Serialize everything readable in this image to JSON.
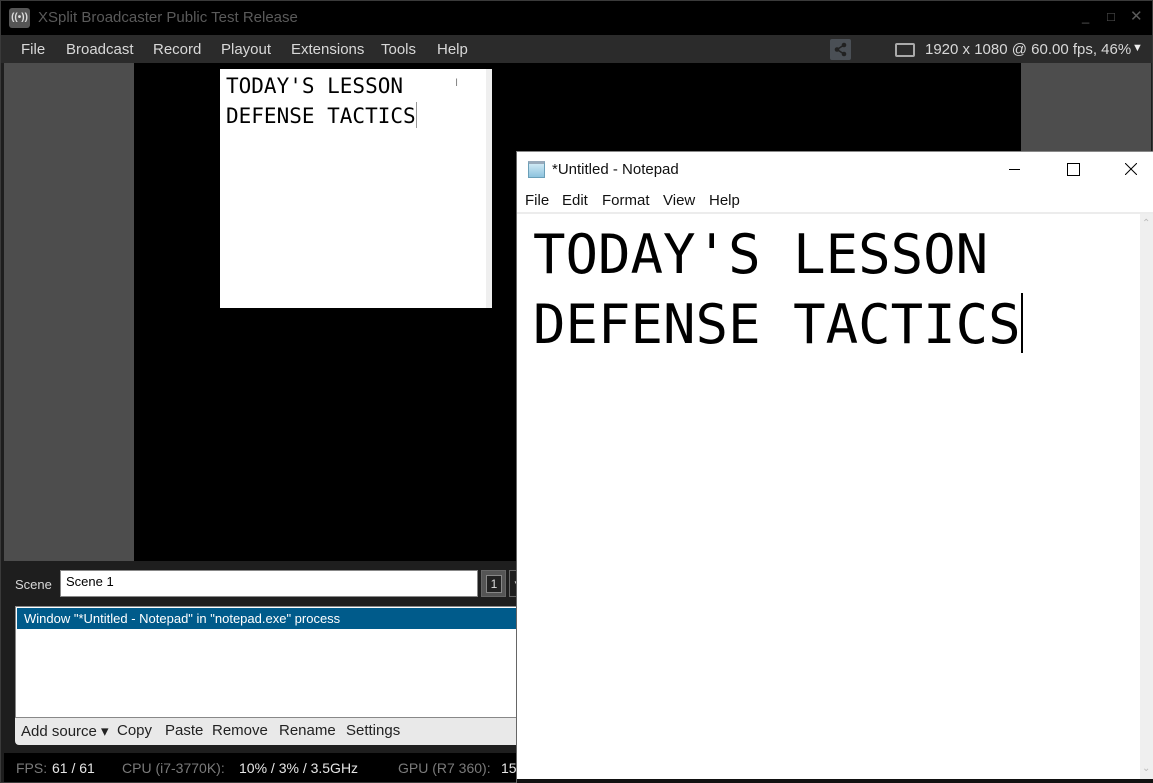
{
  "xsplit": {
    "title": "XSplit Broadcaster Public Test Release",
    "app_icon_glyph": "((•))",
    "window_controls": {
      "minimize": "_",
      "maximize": "□",
      "close": "✕"
    },
    "menu": [
      "File",
      "Broadcast",
      "Record",
      "Playout",
      "Extensions",
      "Tools",
      "Help"
    ],
    "resolution": "1920 x 1080 @ 60.00 fps, 46%",
    "resolution_arrow": "▼",
    "preview": {
      "lines": [
        "TODAY'S LESSON",
        "DEFENSE TACTICS"
      ],
      "cursor_glyph": "I"
    },
    "scene": {
      "label": "Scene",
      "value": "Scene 1",
      "number": "1",
      "dropdown_arrow": "▼"
    },
    "sources": [
      {
        "label": "Window \"*Untitled - Notepad\" in \"notepad.exe\" process",
        "selected": true
      }
    ],
    "source_actions": [
      "Add source ▾",
      "Copy",
      "Paste",
      "Remove",
      "Rename",
      "Settings"
    ],
    "status": {
      "fps_label": "FPS:",
      "fps_value": "61 / 61",
      "cpu_label": "CPU (i7-3770K):",
      "cpu_value": "10% / 3% / 3.5GHz",
      "gpu_label": "GPU (R7 360):",
      "gpu_value": "15"
    }
  },
  "notepad": {
    "title": "*Untitled - Notepad",
    "menu": [
      "File",
      "Edit",
      "Format",
      "View",
      "Help"
    ],
    "lines": [
      "TODAY'S LESSON",
      "DEFENSE TACTICS"
    ],
    "scroll_up": "⌃",
    "scroll_down": "⌄"
  },
  "colors": {
    "selection_blue": "#005b8b",
    "stage_gray": "#4d4d4d"
  }
}
